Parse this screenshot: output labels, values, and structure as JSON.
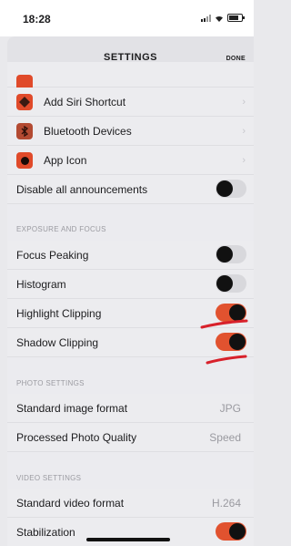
{
  "status": {
    "time": "18:28"
  },
  "nav": {
    "title": "SETTINGS",
    "done_label": "DONE"
  },
  "rows_top": [
    {
      "label": "Add Siri Shortcut",
      "icon": "siri-icon"
    },
    {
      "label": "Bluetooth Devices",
      "icon": "bluetooth-icon"
    },
    {
      "label": "App Icon",
      "icon": "app-icon-icon"
    }
  ],
  "disable_announcements": {
    "label": "Disable all announcements",
    "state": "off"
  },
  "sections": {
    "exposure": {
      "header": "EXPOSURE AND FOCUS",
      "rows": [
        {
          "label": "Focus Peaking",
          "state": "off"
        },
        {
          "label": "Histogram",
          "state": "off"
        },
        {
          "label": "Highlight Clipping",
          "state": "on"
        },
        {
          "label": "Shadow Clipping",
          "state": "on"
        }
      ]
    },
    "photo": {
      "header": "PHOTO SETTINGS",
      "rows": [
        {
          "label": "Standard image format",
          "value": "JPG"
        },
        {
          "label": "Processed Photo Quality",
          "value": "Speed"
        }
      ]
    },
    "video": {
      "header": "VIDEO SETTINGS",
      "rows": [
        {
          "label": "Standard video format",
          "value": "H.264"
        },
        {
          "label": "Stabilization",
          "state": "on"
        }
      ]
    }
  },
  "colors": {
    "accent": "#e1522f",
    "annotation": "#d8212b"
  }
}
